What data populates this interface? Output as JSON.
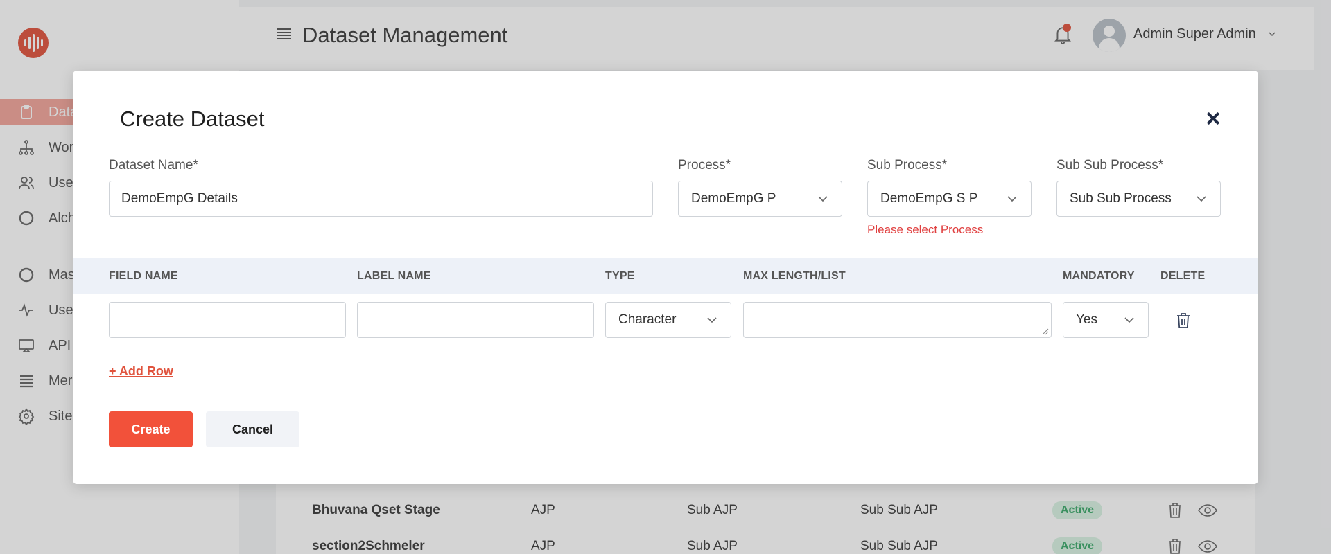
{
  "app": {
    "page_title": "Dataset Management",
    "user_name": "Admin Super Admin",
    "accent_color": "#e0533d"
  },
  "sidebar": {
    "items": [
      {
        "label": "Data",
        "icon": "clipboard-icon",
        "active": true
      },
      {
        "label": "Wor",
        "icon": "workflow-icon"
      },
      {
        "label": "Use",
        "icon": "users-icon"
      },
      {
        "label": "Alch",
        "icon": "circle-icon"
      },
      {
        "label": "Mas",
        "icon": "circle-icon"
      },
      {
        "label": "Use",
        "icon": "activity-icon"
      },
      {
        "label": "API",
        "icon": "monitor-icon"
      },
      {
        "label": "Mer",
        "icon": "list-icon"
      },
      {
        "label": "Site",
        "icon": "gear-icon"
      }
    ]
  },
  "background_table": {
    "rows": [
      {
        "name": "Bhuvana Qset Stage",
        "process": "AJP",
        "sub_process": "Sub AJP",
        "sub_sub_process": "Sub Sub AJP",
        "status": "Active"
      },
      {
        "name": "section2Schmeler",
        "process": "AJP",
        "sub_process": "Sub AJP",
        "sub_sub_process": "Sub Sub AJP",
        "status": "Active"
      }
    ]
  },
  "modal": {
    "title": "Create Dataset",
    "dataset_name_label": "Dataset Name*",
    "dataset_name_value": "DemoEmpG Details",
    "process_label": "Process*",
    "process_value": "DemoEmpG P",
    "sub_process_label": "Sub Process*",
    "sub_process_value": "DemoEmpG S P",
    "sub_process_error": "Please select Process",
    "sub_sub_process_label": "Sub Sub Process*",
    "sub_sub_process_value": "Sub Sub Process",
    "columns": {
      "field_name": "FIELD NAME",
      "label_name": "LABEL NAME",
      "type": "TYPE",
      "max_length": "MAX LENGTH/LIST",
      "mandatory": "MANDATORY",
      "delete": "DELETE"
    },
    "row": {
      "field_name": "",
      "label_name": "",
      "type": "Character",
      "max_length": "",
      "mandatory": "Yes"
    },
    "add_row_label": "+ Add Row",
    "create_label": "Create",
    "cancel_label": "Cancel"
  }
}
